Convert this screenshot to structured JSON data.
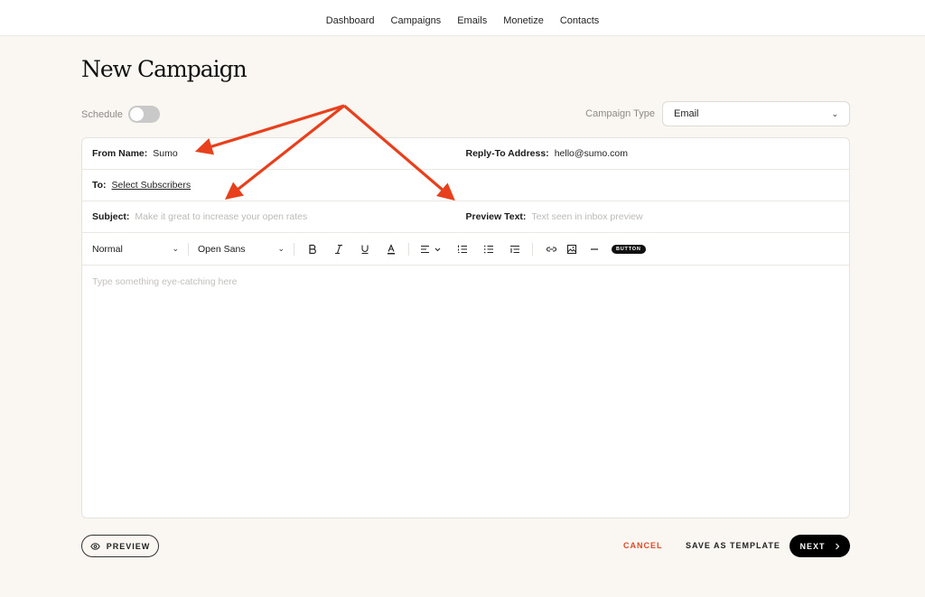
{
  "nav": {
    "items": [
      "Dashboard",
      "Campaigns",
      "Emails",
      "Monetize",
      "Contacts"
    ]
  },
  "page": {
    "title": "New Campaign"
  },
  "schedule": {
    "label": "Schedule",
    "enabled": false
  },
  "campaign_type": {
    "label": "Campaign Type",
    "value": "Email"
  },
  "form": {
    "from_name": {
      "label": "From Name:",
      "value": "Sumo"
    },
    "reply_to": {
      "label": "Reply-To Address:",
      "value": "hello@sumo.com"
    },
    "to": {
      "label": "To:",
      "link": "Select Subscribers"
    },
    "subject": {
      "label": "Subject:",
      "placeholder": "Make it great to increase your open rates"
    },
    "preview_text": {
      "label": "Preview Text:",
      "placeholder": "Text seen in inbox preview"
    }
  },
  "toolbar": {
    "paragraph_style": "Normal",
    "font": "Open Sans",
    "bold_icon": "bold-icon",
    "italic_icon": "italic-icon",
    "underline_icon": "underline-icon",
    "text_color_icon": "text-color-icon",
    "align_icon": "align-left-icon",
    "ordered_list_icon": "ordered-list-icon",
    "bullet_list_icon": "bullet-list-icon",
    "indent_icon": "indent-icon",
    "link_icon": "link-icon",
    "image_icon": "image-icon",
    "divider_icon": "horizontal-rule-icon",
    "button_label": "BUTTON"
  },
  "editor": {
    "placeholder": "Type something eye-catching here"
  },
  "footer": {
    "preview_label": "PREVIEW",
    "cancel_label": "CANCEL",
    "save_template_label": "SAVE AS TEMPLATE",
    "next_label": "NEXT"
  },
  "colors": {
    "accent": "#e04a26",
    "annotation_arrow": "#e8401c",
    "background": "#faf7f3",
    "primary_button": "#000000"
  }
}
